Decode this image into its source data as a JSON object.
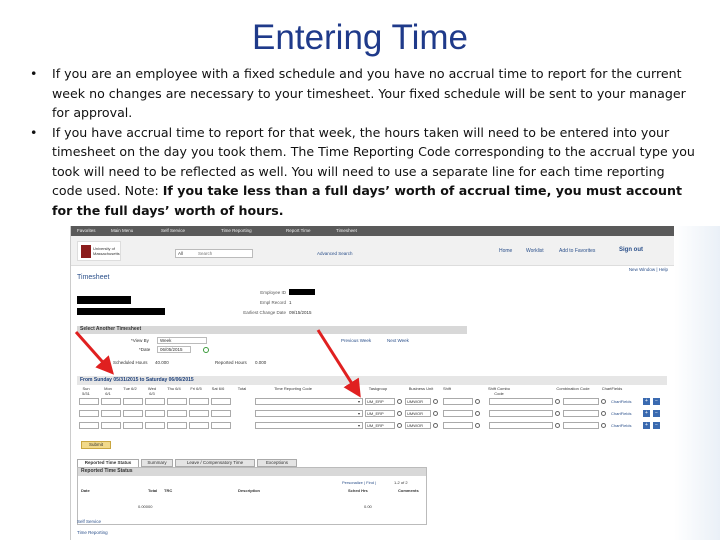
{
  "slide": {
    "title": "Entering Time",
    "bullets": [
      "If you are an employee with a fixed schedule and you have no accrual time to report for the current week no changes are necessary to your timesheet.  Your fixed schedule will be sent to your manager for approval.",
      "If you have accrual time to report for that week, the hours taken will need to be entered into your timesheet on the day you took them.  The Time Reporting Code corresponding to the accrual type you took will need to be reflected as well.  You will need to use a separate line for each time reporting code used.  Note:  "
    ],
    "bullet2_bold": "If you take less than a full days’ worth of accrual time, you must account for the full days’ worth of hours."
  },
  "app": {
    "topnav": [
      "Favorites",
      "Main Menu",
      "Self Service",
      "Time Reporting",
      "Report Time",
      "Timesheet"
    ],
    "logo_text": "University of Massachusetts",
    "header_links": [
      "Home",
      "Worklist",
      "Add to Favorites",
      "Sign out"
    ],
    "search_scope": "All",
    "search_placeholder": "Search",
    "advanced_search": "Advanced Search",
    "new_window": "New Window | Help",
    "page_title": "Timesheet",
    "info": {
      "employee_id_label": "Employee ID",
      "empl_record_label": "Empl Record",
      "empl_record_value": "1",
      "earliest_change_label": "Earliest Change Date",
      "earliest_change_value": "09/15/2015"
    },
    "select_section": "Select Another Timesheet",
    "view_by_label": "*View By",
    "view_by_value": "Week",
    "date_label": "*Date",
    "date_value": "06/05/2015",
    "previous_week": "Previous Week",
    "next_week": "Next Week",
    "scheduled_hours_label": "Scheduled Hours",
    "scheduled_hours_value": "40.000",
    "reported_hours_label": "Reported Hours",
    "reported_hours_value": "0.000",
    "week_range": "From Sunday 05/31/2015 to Saturday 06/06/2015",
    "columns": [
      "Sun 5/31",
      "Mon 6/1",
      "Tue 6/2",
      "Wed 6/3",
      "Thu 6/4",
      "Fri 6/5",
      "Sat 6/6",
      "Total",
      "Time Reporting Code",
      "Taskgroup",
      "Business Unit",
      "Shift",
      "Shift Combo Code",
      "Combination Code",
      "ChartFields"
    ],
    "rows": [
      {
        "taskgroup": "UM_ERP",
        "business_unit": "UMWOR",
        "chartfields": "ChartFields"
      },
      {
        "taskgroup": "UM_ERP",
        "business_unit": "UMWOR",
        "chartfields": "ChartFields"
      },
      {
        "taskgroup": "UM_ERP",
        "business_unit": "UMWOR",
        "chartfields": "ChartFields"
      }
    ],
    "submit": "Submit",
    "tabs": [
      "Reported Time Status",
      "Summary",
      "Leave / Compensatory Time",
      "Exceptions"
    ],
    "panel_title": "Reported Time Status",
    "panel_nav": "Personalize | Find |",
    "panel_pager": "1-2 of 2",
    "panel_cols": [
      "Date",
      "Total",
      "TRC",
      "Description",
      "Sched Hrs",
      "Comments"
    ],
    "panel_total": "0.00000",
    "panel_sched": "0.00",
    "footer_links": [
      "Self Service",
      "Time Reporting"
    ]
  },
  "colors": {
    "title": "#1f3a8a",
    "arrow": "#e02020",
    "link": "#2a4f8a"
  }
}
